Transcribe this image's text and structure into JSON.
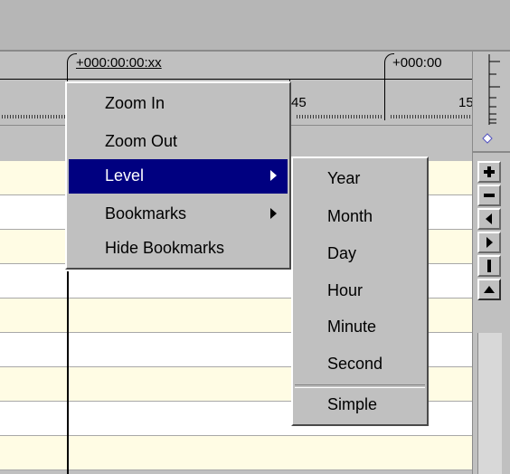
{
  "ruler": {
    "label_left": "+000:00:00:xx",
    "label_right": "+000:00",
    "tick_a": "45",
    "tick_b": "15"
  },
  "context_menu": {
    "items": [
      {
        "label": "Zoom In"
      },
      {
        "label": "Zoom Out"
      },
      {
        "label": "Level",
        "submenu": true,
        "selected": true
      },
      {
        "label": "Bookmarks",
        "submenu": true
      },
      {
        "label": "Hide Bookmarks"
      }
    ]
  },
  "level_submenu": {
    "items": [
      "Year",
      "Month",
      "Day",
      "Hour",
      "Minute",
      "Second",
      "Simple"
    ]
  },
  "scroll_buttons": [
    "zoom-in",
    "zoom-out",
    "scroll-left",
    "scroll-right",
    "pause",
    "scroll-up"
  ],
  "colors": {
    "row_yellow": "#fffce4",
    "row_white": "#ffffff",
    "menu_highlight": "#000080"
  }
}
